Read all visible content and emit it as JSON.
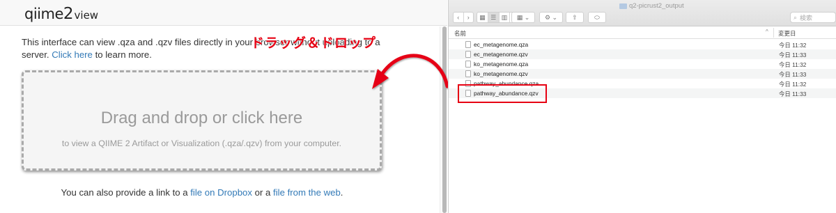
{
  "qiime_view": {
    "logo_text": "qiime",
    "logo_number": "2",
    "logo_suffix": "view",
    "intro_part1": "This interface can view .qza and .qzv files directly in your browser without uploading to a",
    "intro_part2": "server.",
    "intro_link": "Click here",
    "intro_part3": "to learn more.",
    "drop_title": "Drag and drop or click here",
    "drop_subtitle": "to view a QIIME 2 Artifact or Visualization (.qza/.qzv) from your computer.",
    "bottom_part1": "You can also provide a link to a",
    "bottom_link1": "file on Dropbox",
    "bottom_part2": "or a",
    "bottom_link2": "file from the web",
    "bottom_part3": "."
  },
  "annotation": {
    "label": "ドラッグ＆ドロップ",
    "color": "#e60012"
  },
  "finder": {
    "window_title": "q2-picrust2_output",
    "search_placeholder": "検索",
    "column_name": "名前",
    "column_date": "変更日",
    "sort_indicator": "^",
    "files": [
      {
        "name": "ec_metagenome.qza",
        "date": "今日 11:32"
      },
      {
        "name": "ec_metagenome.qzv",
        "date": "今日 11:33"
      },
      {
        "name": "ko_metagenome.qza",
        "date": "今日 11:32"
      },
      {
        "name": "ko_metagenome.qzv",
        "date": "今日 11:33"
      },
      {
        "name": "pathway_abundance.qza",
        "date": "今日 11:32"
      },
      {
        "name": "pathway_abundance.qzv",
        "date": "今日 11:33"
      }
    ],
    "highlighted_file": "pathway_abundance.qzv"
  }
}
